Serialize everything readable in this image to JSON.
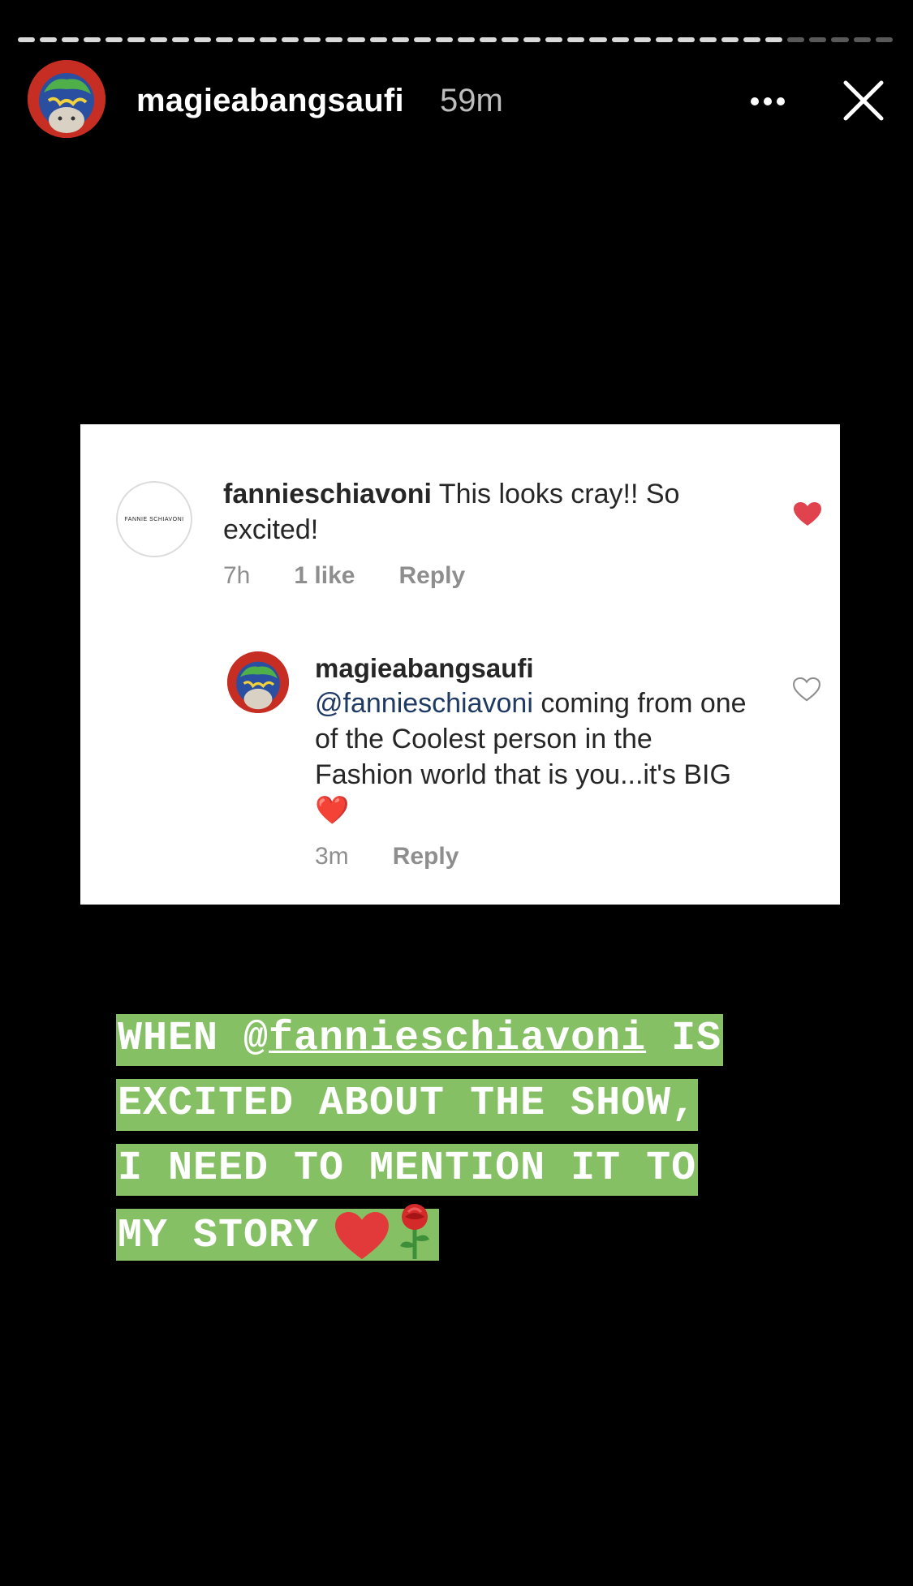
{
  "story": {
    "segments_total": 40,
    "segments_viewed": 35,
    "progress": 0.88
  },
  "header": {
    "username": "magieabangsaufi",
    "time": "59m",
    "more_icon": "more-horizontal-icon",
    "close_icon": "close-icon"
  },
  "card": {
    "comment": {
      "avatar_text": "FANNIE SCHIAVONI",
      "username": "fannieschiavoni",
      "text": " This looks cray!! So excited!",
      "time": "7h",
      "likes": "1 like",
      "reply": "Reply",
      "liked": true
    },
    "reply": {
      "username": "magieabangsaufi",
      "mention": "@fannieschiavoni",
      "text": " coming from one of the Coolest person in the Fashion world that is you...it's BIG",
      "emoji": "❤️",
      "time": "3m",
      "reply": "Reply",
      "liked": false
    }
  },
  "caption": {
    "line1_a": "WHEN @",
    "line1_mention": "fannieschiavoni",
    "line1_b": " IS",
    "line2": "EXCITED ABOUT THE SHOW,",
    "line3": "I NEED TO MENTION IT TO",
    "line4": "MY STORY",
    "emojis": [
      "❤️",
      "🌹"
    ],
    "bg_color": "#86c064"
  },
  "colors": {
    "heart_red": "#e0424e",
    "mention_blue": "#1f3a63"
  }
}
